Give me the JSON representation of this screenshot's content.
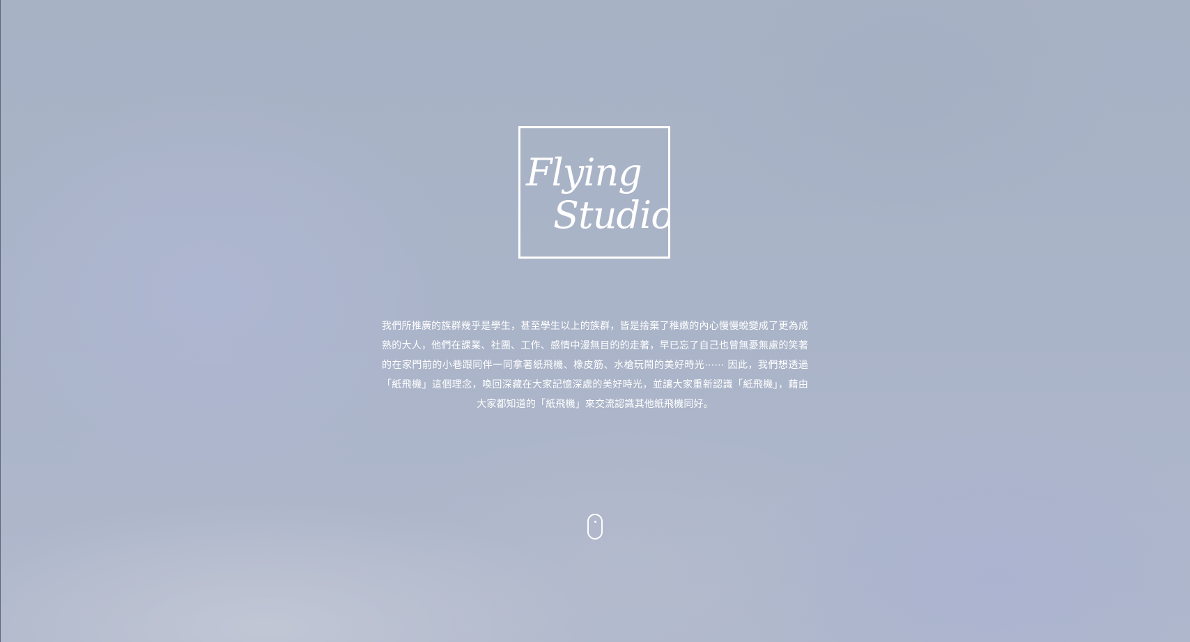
{
  "hero": {
    "logo": {
      "line1": "Flying",
      "line2": "Studio"
    },
    "intro": "我們所推廣的族群幾乎是學生，甚至學生以上的族群，皆是捨棄了稚嫩的內心慢慢蛻變成了更為成熟的大人，他們在課業、社團、工作、感情中漫無目的的走著，早已忘了自己也曾無憂無慮的笑著的在家門前的小巷跟同伴一同拿著紙飛機、橡皮筋、水槍玩鬧的美好時光⋯⋯ 因此，我們想透過「紙飛機」這個理念，喚回深藏在大家記憶深處的美好時光，並讓大家重新認識「紙飛機」，藉由大家都知道的「紙飛機」來交流認識其他紙飛機同好。",
    "scroll_indicator_icon": "mouse-scroll-icon"
  },
  "colors": {
    "text": "#ffffff",
    "background": "#a9b3c6"
  }
}
